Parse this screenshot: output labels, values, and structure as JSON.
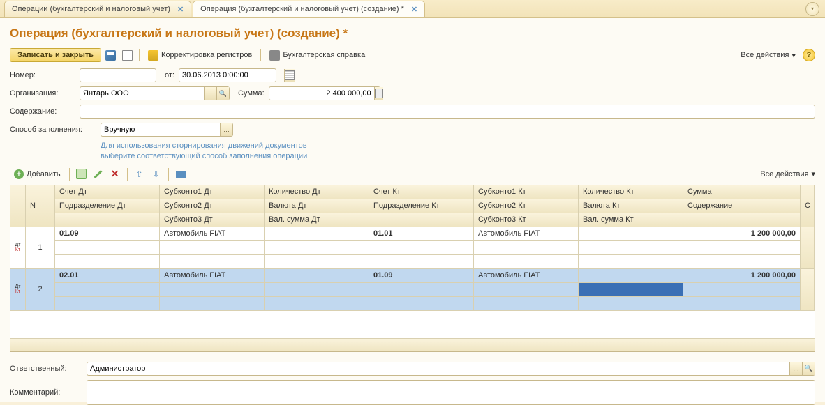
{
  "tabs": {
    "tab1": "Операции (бухгалтерский и налоговый учет)",
    "tab2": "Операция (бухгалтерский и налоговый учет) (создание) *"
  },
  "pageTitle": "Операция (бухгалтерский и налоговый учет) (создание) *",
  "toolbar": {
    "saveClose": "Записать и закрыть",
    "correction": "Корректировка регистров",
    "refDoc": "Бухгалтерская справка",
    "allActions": "Все действия"
  },
  "labels": {
    "number": "Номер:",
    "from": "от:",
    "org": "Организация:",
    "sum": "Сумма:",
    "content": "Содержание:",
    "fillMethod": "Способ заполнения:",
    "responsible": "Ответственный:",
    "comment": "Комментарий:"
  },
  "values": {
    "number": "",
    "date": "30.06.2013 0:00:00",
    "org": "Янтарь ООО",
    "sum": "2 400 000,00",
    "content": "",
    "fillMethod": "Вручную",
    "responsible": "Администратор",
    "comment": ""
  },
  "hint": {
    "line1": "Для использования сторнирования движений документов",
    "line2": "выберите соответствующий способ заполнения операции"
  },
  "tableToolbar": {
    "add": "Добавить"
  },
  "headers": {
    "n": "N",
    "accDt": "Счет Дт",
    "sub1Dt": "Субконто1 Дт",
    "qtyDt": "Количество Дт",
    "accKt": "Счет Кт",
    "sub1Kt": "Субконто1 Кт",
    "qtyKt": "Количество Кт",
    "amount": "Сумма",
    "deptDt": "Подразделение Дт",
    "sub2Dt": "Субконто2 Дт",
    "curDt": "Валюта Дт",
    "deptKt": "Подразделение Кт",
    "sub2Kt": "Субконто2 Кт",
    "curKt": "Валюта Кт",
    "desc": "Содержание",
    "sub3Dt": "Субконто3 Дт",
    "curSumDt": "Вал. сумма Дт",
    "sub3Kt": "Субконто3 Кт",
    "curSumKt": "Вал. сумма Кт",
    "c": "С"
  },
  "rows": [
    {
      "n": "1",
      "accDt": "01.09",
      "sub1Dt": "Автомобиль FIAT",
      "accKt": "01.01",
      "sub1Kt": "Автомобиль FIAT",
      "amount": "1 200 000,00"
    },
    {
      "n": "2",
      "accDt": "02.01",
      "sub1Dt": "Автомобиль FIAT",
      "accKt": "01.09",
      "sub1Kt": "Автомобиль FIAT",
      "amount": "1 200 000,00"
    }
  ]
}
